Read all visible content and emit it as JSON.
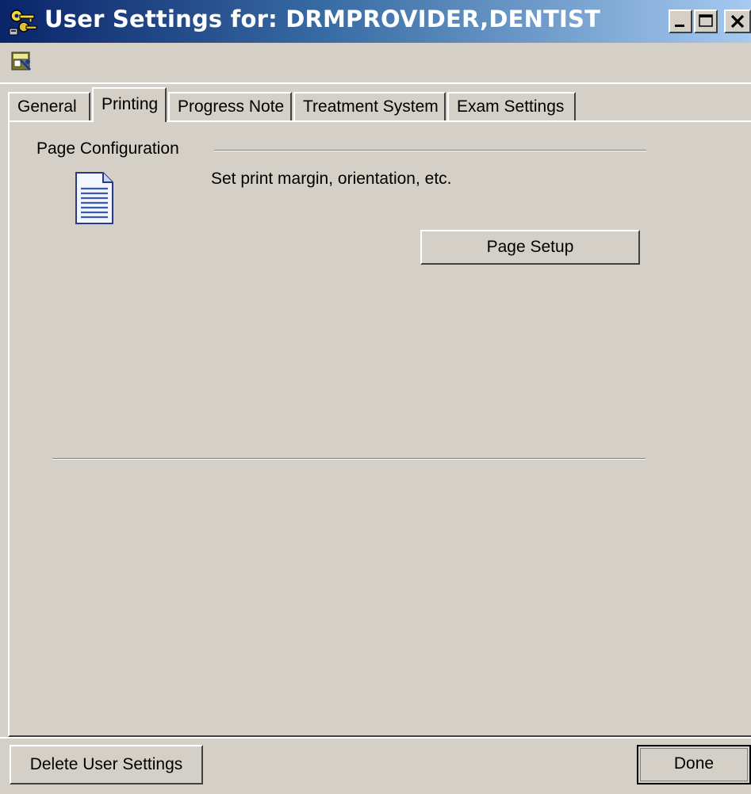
{
  "window": {
    "title": "User Settings for: DRMPROVIDER,DENTIST",
    "app_icon": "keys-icon",
    "controls": [
      "minimize-icon",
      "maximize-icon",
      "close-icon"
    ]
  },
  "toolbar": {
    "icons": [
      "user-settings-icon"
    ]
  },
  "tabs": [
    {
      "label": "General",
      "active": false
    },
    {
      "label": "Printing",
      "active": true
    },
    {
      "label": "Progress Note",
      "active": false
    },
    {
      "label": "Treatment System",
      "active": false
    },
    {
      "label": "Exam Settings",
      "active": false
    }
  ],
  "printing": {
    "section_label": "Page Configuration",
    "icon": "document-icon",
    "description": "Set  print margin, orientation, etc.",
    "page_setup_label": "Page Setup"
  },
  "footer": {
    "delete_label": "Delete User Settings",
    "done_label": "Done"
  },
  "colors": {
    "face": "#d4d0c8",
    "title_active_start": "#0a246a",
    "title_active_end": "#a6caf0",
    "title_text": "#ffffff"
  }
}
